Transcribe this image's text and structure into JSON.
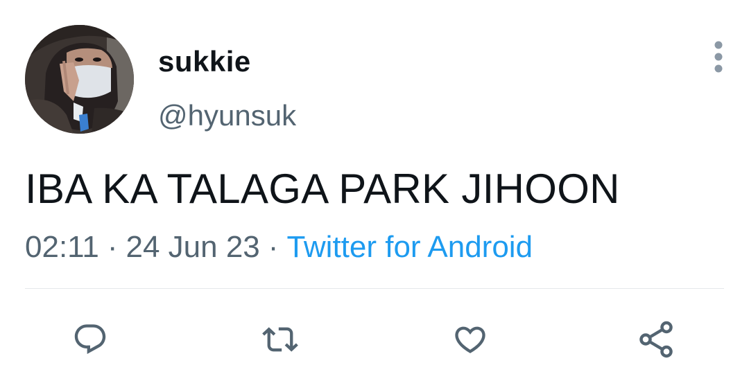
{
  "user": {
    "display_name": "sukkie",
    "handle": "@hyunsuk",
    "avatar_icon": "profile-photo"
  },
  "tweet": {
    "text": "IBA KA TALAGA PARK JIHOON",
    "time": "02:11",
    "date": "24 Jun 23",
    "source": "Twitter for Android",
    "separator": "·"
  },
  "actions": [
    {
      "icon": "reply-icon"
    },
    {
      "icon": "retweet-icon"
    },
    {
      "icon": "like-icon"
    },
    {
      "icon": "share-icon"
    }
  ],
  "menu": {
    "icon": "more-vertical-icon"
  },
  "colors": {
    "text_primary": "#0f1419",
    "text_secondary": "#536471",
    "link": "#1d9bf0",
    "icon": "#536471",
    "divider": "#e5e8eb",
    "background": "#ffffff"
  }
}
